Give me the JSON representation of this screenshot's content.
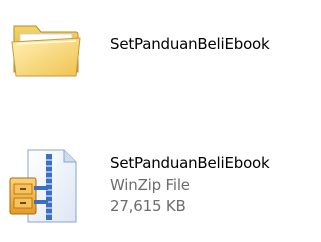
{
  "items": [
    {
      "name": "SetPanduanBeliEbook",
      "icon": "folder-icon"
    },
    {
      "name": "SetPanduanBeliEbook",
      "type": "WinZip File",
      "size": "27,615 KB",
      "icon": "winzip-file-icon"
    }
  ],
  "colors": {
    "text": "#000000",
    "meta_text": "#6d6d6d",
    "folder_yellow": "#f6d264",
    "zip_blue": "#3c6fbf"
  }
}
